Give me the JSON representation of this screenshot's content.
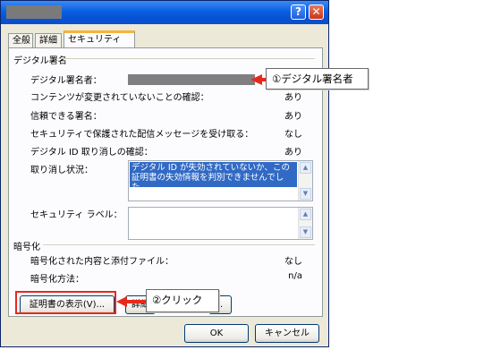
{
  "tabs": [
    "全般",
    "詳細",
    "セキュリティ"
  ],
  "active_tab_index": 2,
  "digital_signature": {
    "group_title": "デジタル署名",
    "rows": [
      {
        "label": "デジタル署名者：",
        "value": ""
      },
      {
        "label": "コンテンツが変更されていないことの確認：",
        "value": "あり"
      },
      {
        "label": "信頼できる署名：",
        "value": "あり"
      },
      {
        "label": "セキュリティで保護された配信メッセージを受け取る：",
        "value": "なし"
      },
      {
        "label": "デジタル ID 取り消しの確認：",
        "value": "あり"
      }
    ],
    "revocation_label": "取り消し状況：",
    "revocation_text": "デジタル ID が失効されていないか、この証明書の失効情報を判別できませんでした。",
    "security_label_label": "セキュリティ ラベル："
  },
  "encryption": {
    "group_title": "暗号化",
    "rows": [
      {
        "label": "暗号化された内容と添付ファイル：",
        "value": "なし"
      },
      {
        "label": "暗号化方法：",
        "value": "n/a"
      }
    ]
  },
  "buttons": {
    "view_certificate": "証明書の表示(V)...",
    "details_partial": "詳細",
    "third_partial": "..",
    "ok": "OK",
    "cancel": "キャンセル"
  },
  "annotations": {
    "signer": "①デジタル署名者",
    "click": "②クリック"
  },
  "colors": {
    "annotation_red": "#e8281c",
    "selection_blue": "#316ac5",
    "titlebar_blue": "#0a5fe0"
  }
}
